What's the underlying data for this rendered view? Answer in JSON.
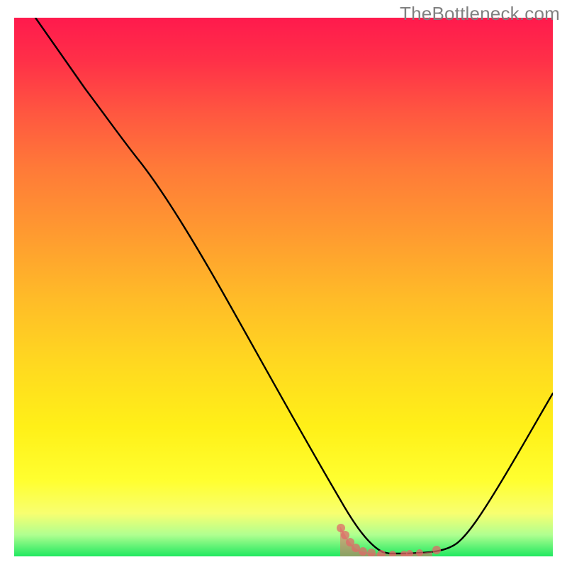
{
  "watermark": "TheBottleneck.com",
  "chart_data": {
    "type": "line",
    "title": "",
    "xlabel": "",
    "ylabel": "",
    "x": [
      0,
      5,
      10,
      15,
      20,
      25,
      30,
      35,
      40,
      45,
      50,
      55,
      60,
      65,
      67,
      70,
      73,
      75,
      78,
      80,
      85,
      90,
      95,
      100
    ],
    "values": [
      100,
      94,
      88,
      82,
      76,
      70,
      60,
      50,
      40,
      30,
      20,
      12,
      6,
      2,
      1,
      0,
      0,
      0,
      0,
      1,
      5,
      11,
      18,
      26
    ],
    "xlim": [
      0,
      100
    ],
    "ylim": [
      0,
      100
    ],
    "background_gradient": {
      "stops": [
        {
          "pos": 0,
          "color": "#ff1a4d"
        },
        {
          "pos": 50,
          "color": "#ffbb28"
        },
        {
          "pos": 90,
          "color": "#ffff30"
        },
        {
          "pos": 100,
          "color": "#20e860"
        }
      ]
    },
    "markers": {
      "color": "#e06868",
      "points_x": [
        60,
        61,
        62,
        63,
        64,
        65,
        66,
        68,
        70,
        72,
        74,
        76,
        78
      ],
      "points_y": [
        5,
        4,
        3.2,
        2.6,
        2.2,
        1.8,
        1.5,
        1.2,
        1.0,
        0.8,
        0.7,
        0.8,
        1.4
      ]
    }
  }
}
